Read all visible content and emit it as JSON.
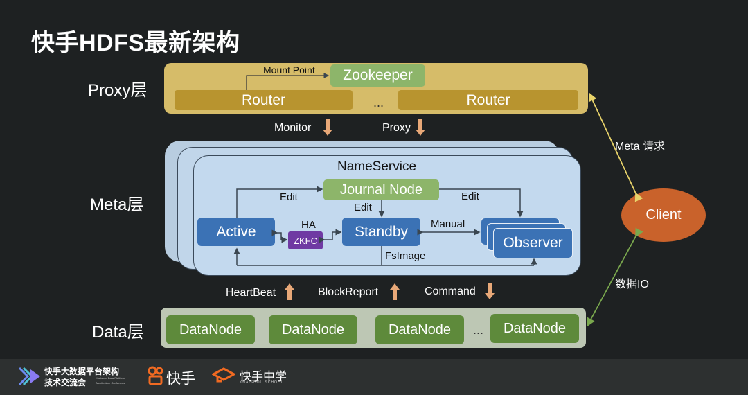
{
  "title": "快手HDFS最新架构",
  "layers": {
    "proxy": "Proxy层",
    "meta": "Meta层",
    "data": "Data层"
  },
  "proxy": {
    "zookeeper": "Zookeeper",
    "mount_point": "Mount Point",
    "routers": [
      "Router",
      "Router"
    ],
    "ellipsis": "..."
  },
  "proxy_to_meta": {
    "monitor": "Monitor",
    "proxy": "Proxy"
  },
  "meta": {
    "nameservice": "NameService",
    "journal_node": "Journal Node",
    "edit_left": "Edit",
    "edit_mid": "Edit",
    "edit_right": "Edit",
    "active": "Active",
    "ha": "HA",
    "zkfc": "ZKFC",
    "standby": "Standby",
    "manual": "Manual",
    "observer": "Observer",
    "fsimage": "FsImage"
  },
  "data_to_meta": {
    "heartbeat": "HeartBeat",
    "blockreport": "BlockReport",
    "command": "Command"
  },
  "data": {
    "nodes": [
      "DataNode",
      "DataNode",
      "DataNode",
      "DataNode"
    ],
    "ellipsis": "..."
  },
  "client": {
    "label": "Client",
    "meta_request": "Meta 请求",
    "data_io": "数据IO"
  },
  "colors": {
    "background": "#1e2122",
    "proxy_layer": "#d6bc69",
    "router": "#b8942f",
    "green_node": "#8db56a",
    "meta_layer": "#c3d9ee",
    "blue_node": "#3b72b5",
    "zkfc": "#6f3aa3",
    "data_layer": "#bdc7b4",
    "datanode": "#5e8a3b",
    "client": "#c9622b",
    "flow_arrow": "#e8a878",
    "meta_request_line": "#e8d36a",
    "data_io_line": "#7aa84e"
  },
  "footer": {
    "conference_line1": "快手大数据平台架构",
    "conference_line2": "技术交流会",
    "conference_en1": "Kuaishou Data Platform",
    "conference_en2": "Architecture Conference",
    "kuaishou_logo": "快手",
    "school_logo": "快手中学",
    "school_en": "KUAISHOU SCHOOL"
  }
}
